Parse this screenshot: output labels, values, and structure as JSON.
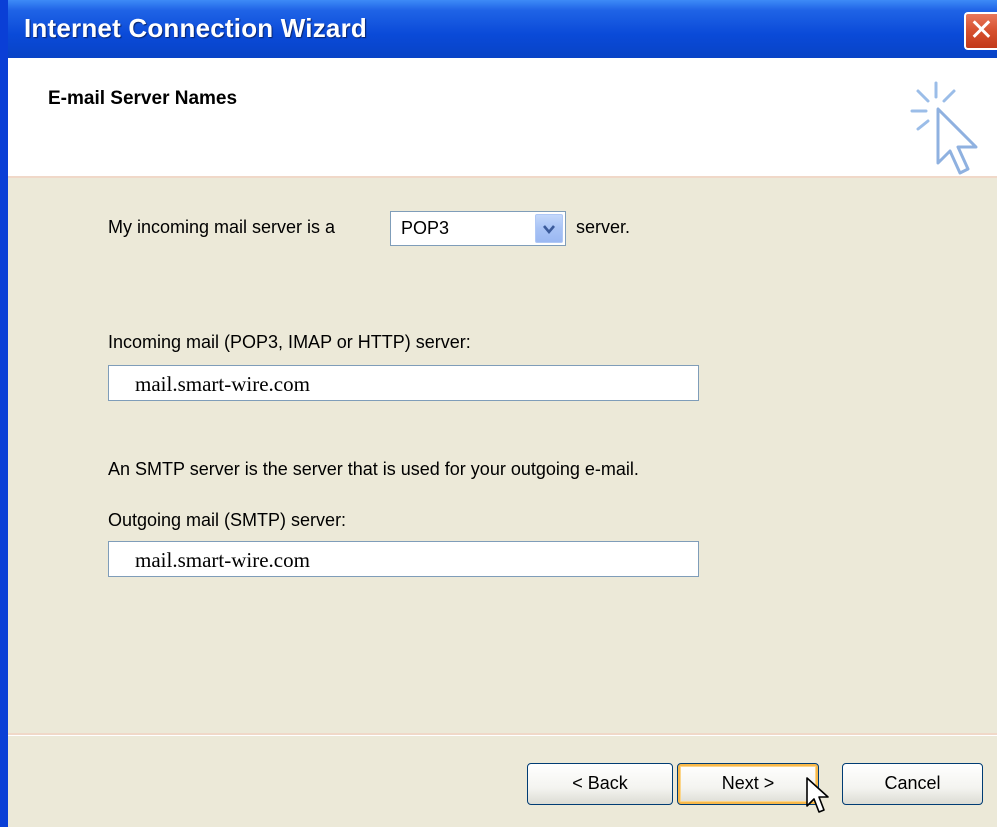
{
  "window": {
    "title": "Internet Connection Wizard",
    "close_glyph": "✕"
  },
  "header": {
    "heading": "E-mail Server Names",
    "icon": "wizard-cursor-sparkle-icon"
  },
  "form": {
    "incoming_type_prefix": "My incoming mail server is a",
    "incoming_type_value": "POP3",
    "incoming_type_suffix": "server.",
    "incoming_label": "Incoming mail (POP3, IMAP or HTTP) server:",
    "incoming_value": "mail.smart-wire.com",
    "smtp_note": "An SMTP server is the server that is used for your outgoing e-mail.",
    "outgoing_label": "Outgoing mail (SMTP) server:",
    "outgoing_value": "mail.smart-wire.com"
  },
  "buttons": {
    "back": "< Back",
    "next": "Next >",
    "cancel": "Cancel"
  },
  "colors": {
    "titlebar": "#0a4ad8",
    "border": "#0a3fd6",
    "dialog_bg": "#ece9d8",
    "close_button": "#d6502e",
    "default_button_highlight": "#f8b84a"
  }
}
